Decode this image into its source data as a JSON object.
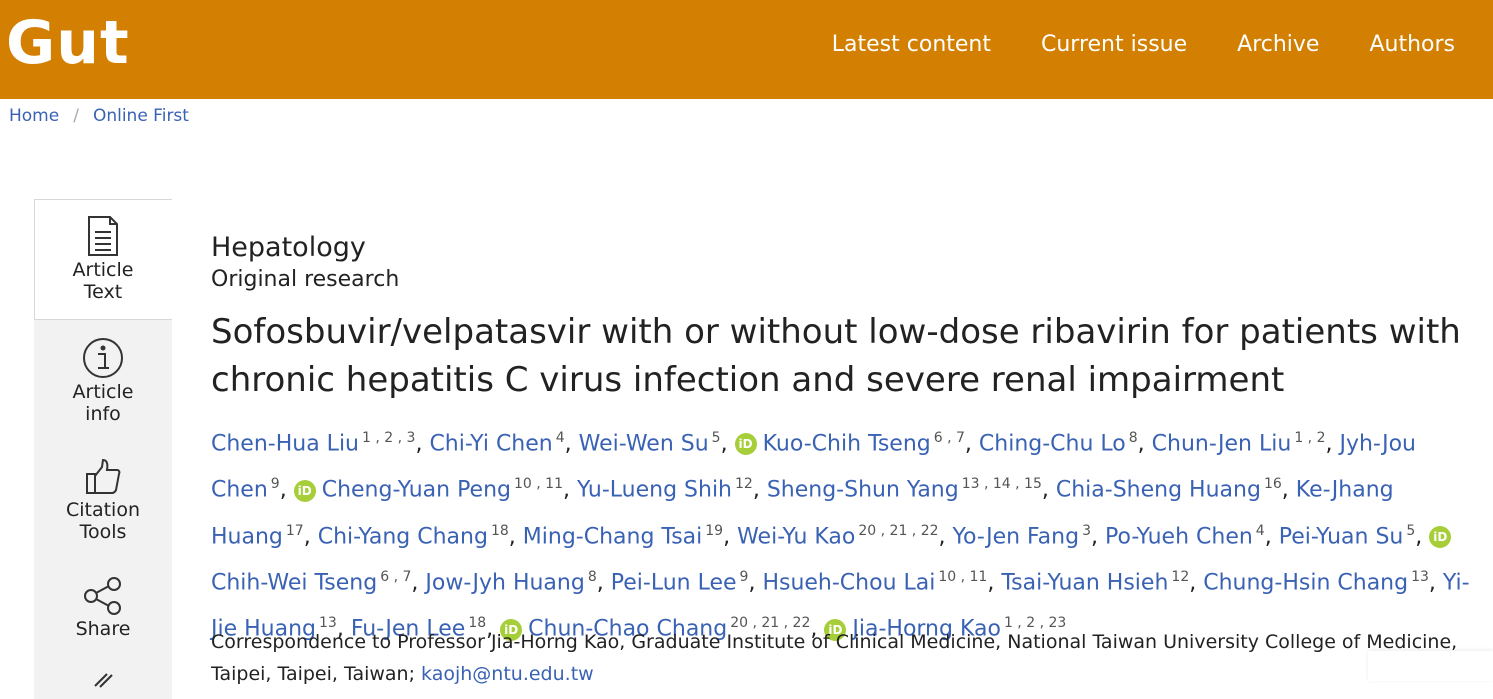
{
  "brand": {
    "logo": "Gut",
    "accent": "#d37f02",
    "link_color": "#3a62b4",
    "orcid_color": "#a6ce39"
  },
  "topnav": [
    "Latest content",
    "Current issue",
    "Archive",
    "Authors"
  ],
  "breadcrumb": {
    "home": "Home",
    "separator": "/",
    "current": "Online First"
  },
  "sidebar": [
    {
      "label": "Article Text",
      "icon": "document-icon"
    },
    {
      "label": "Article info",
      "icon": "info-icon"
    },
    {
      "label": "Citation Tools",
      "icon": "thumbs-up-icon"
    },
    {
      "label": "Share",
      "icon": "share-icon"
    }
  ],
  "article": {
    "section": "Hepatology",
    "subsection": "Original research",
    "title": "Sofosbuvir/velpatasvir with or without low-dose ribavirin for patients with chronic hepatitis C virus infection and severe renal impairment",
    "orcid_glyph": "iD",
    "authors": [
      {
        "name": "Chen-Hua Liu",
        "aff": "1 , 2 , 3",
        "orcid": false,
        "sep": ", "
      },
      {
        "name": "Chi-Yi Chen",
        "aff": "4",
        "orcid": false,
        "sep": ", "
      },
      {
        "name": "Wei-Wen Su",
        "aff": "5",
        "orcid": false,
        "sep": ", "
      },
      {
        "name": "Kuo-Chih Tseng",
        "aff": "6 , 7",
        "orcid": true,
        "sep": ", "
      },
      {
        "name": "Ching-Chu Lo",
        "aff": "8",
        "orcid": false,
        "sep": ", "
      },
      {
        "name": "Chun-Jen Liu",
        "aff": "1 , 2",
        "orcid": false,
        "sep": ", "
      },
      {
        "name": "Jyh-Jou Chen",
        "aff": "9",
        "orcid": false,
        "sep": ", "
      },
      {
        "name": "Cheng-Yuan Peng",
        "aff": "10 , 11",
        "orcid": true,
        "sep": ", "
      },
      {
        "name": "Yu-Lueng Shih",
        "aff": "12",
        "orcid": false,
        "sep": ", "
      },
      {
        "name": "Sheng-Shun Yang",
        "aff": "13 , 14 , 15",
        "orcid": false,
        "sep": ", "
      },
      {
        "name": "Chia-Sheng Huang",
        "aff": "16",
        "orcid": false,
        "sep": ", "
      },
      {
        "name": "Ke-Jhang Huang",
        "aff": "17",
        "orcid": false,
        "sep": ", "
      },
      {
        "name": "Chi-Yang Chang",
        "aff": "18",
        "orcid": false,
        "sep": ", "
      },
      {
        "name": "Ming-Chang Tsai",
        "aff": "19",
        "orcid": false,
        "sep": ", "
      },
      {
        "name": "Wei-Yu Kao",
        "aff": "20 , 21 , 22",
        "orcid": false,
        "sep": ", "
      },
      {
        "name": "Yo-Jen Fang",
        "aff": "3",
        "orcid": false,
        "sep": ", "
      },
      {
        "name": "Po-Yueh Chen",
        "aff": "4",
        "orcid": false,
        "sep": ", "
      },
      {
        "name": "Pei-Yuan Su",
        "aff": "5",
        "orcid": false,
        "sep": ", "
      },
      {
        "name": "Chih-Wei Tseng",
        "aff": "6 , 7",
        "orcid": true,
        "sep": ", "
      },
      {
        "name": "Jow-Jyh Huang",
        "aff": "8",
        "orcid": false,
        "sep": ", "
      },
      {
        "name": "Pei-Lun Lee",
        "aff": "9",
        "orcid": false,
        "sep": ", "
      },
      {
        "name": "Hsueh-Chou Lai",
        "aff": "10 , 11",
        "orcid": false,
        "sep": ", "
      },
      {
        "name": "Tsai-Yuan Hsieh",
        "aff": "12",
        "orcid": false,
        "sep": ", "
      },
      {
        "name": "Chung-Hsin Chang",
        "aff": "13",
        "orcid": false,
        "sep": ", "
      },
      {
        "name": "Yi-Jie Huang",
        "aff": "13",
        "orcid": false,
        "sep": ", "
      },
      {
        "name": "Fu-Jen Lee",
        "aff": "18",
        "orcid": false,
        "sep": ", "
      },
      {
        "name": "Chun-Chao Chang",
        "aff": "20 , 21 , 22",
        "orcid": true,
        "sep": ", "
      },
      {
        "name": "Jia-Horng Kao",
        "aff": "1 , 2 , 23",
        "orcid": true,
        "sep": ""
      }
    ],
    "correspondence_text": "Correspondence to Professor Jia-Horng Kao, Graduate Institute of Clinical Medicine, National Taiwan University College of Medicine, Taipei, Taipei, Taiwan; ",
    "correspondence_email": "kaojh@ntu.edu.tw"
  }
}
